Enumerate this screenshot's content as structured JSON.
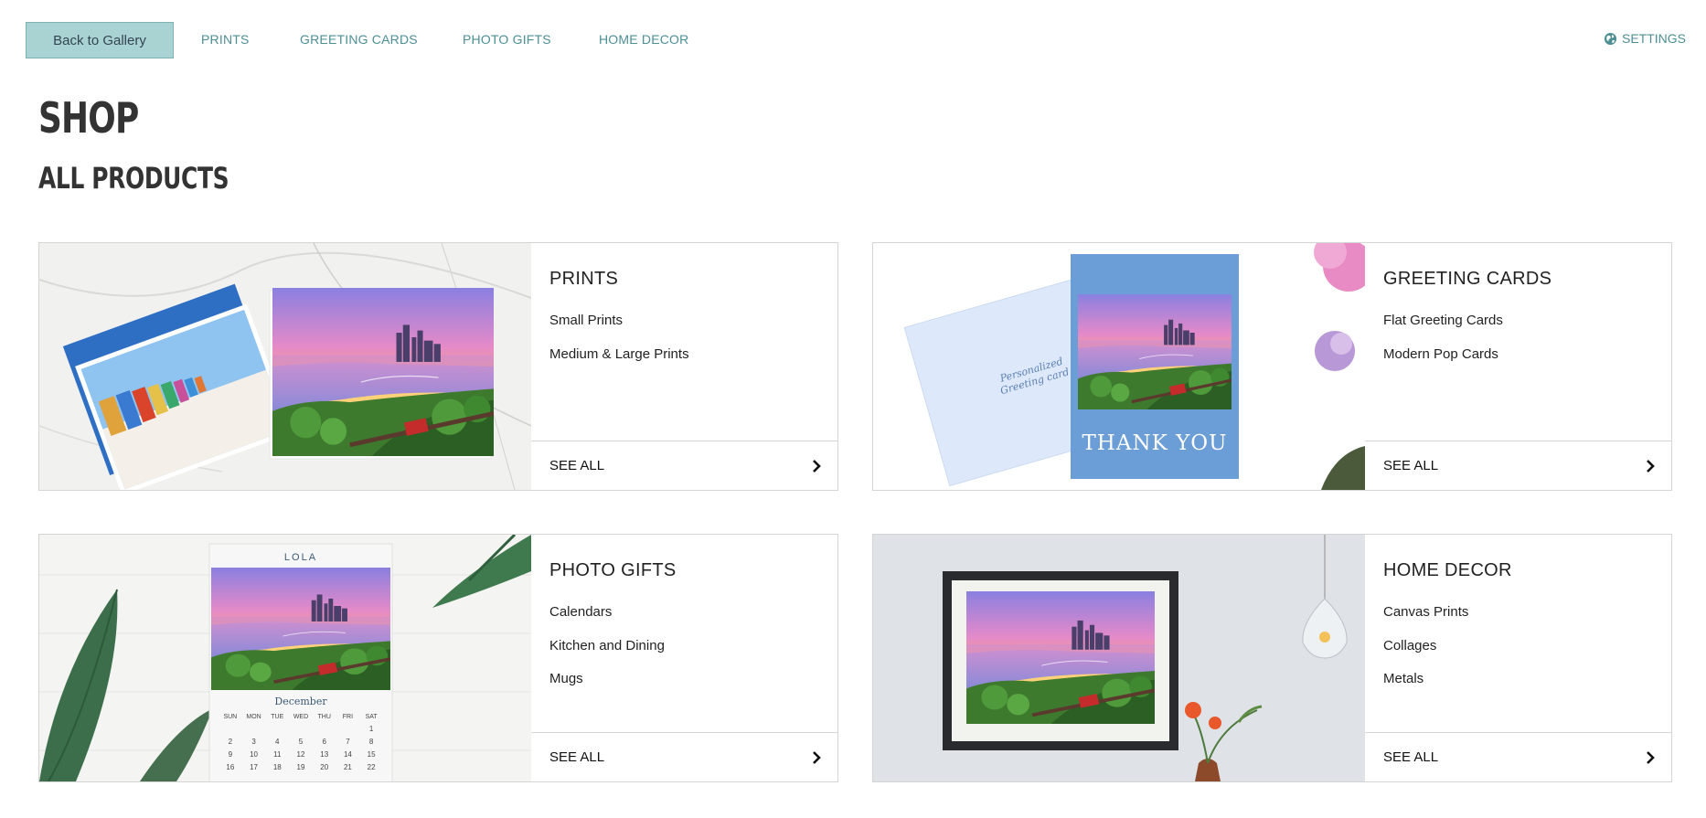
{
  "nav": {
    "back_label": "Back to Gallery",
    "links": [
      "PRINTS",
      "GREETING CARDS",
      "PHOTO GIFTS",
      "HOME DECOR"
    ],
    "settings_label": "SETTINGS",
    "settings_icon": "globe-icon"
  },
  "page": {
    "title": "SHOP",
    "subtitle": "ALL PRODUCTS"
  },
  "cards": [
    {
      "title": "PRINTS",
      "links": [
        "Small Prints",
        "Medium & Large Prints"
      ],
      "see_all": "SEE ALL"
    },
    {
      "title": "GREETING CARDS",
      "links": [
        "Flat Greeting Cards",
        "Modern Pop Cards"
      ],
      "see_all": "SEE ALL",
      "image_text": {
        "envelope": "Personalized Greeting card",
        "card": "THANK YOU"
      }
    },
    {
      "title": "PHOTO GIFTS",
      "links": [
        "Calendars",
        "Kitchen and Dining",
        "Mugs"
      ],
      "see_all": "SEE ALL",
      "image_text": {
        "calendar_name": "LOLA",
        "month": "December",
        "weekdays": [
          "SUN",
          "MON",
          "TUE",
          "WED",
          "THU",
          "FRI",
          "SAT"
        ],
        "days": [
          "1",
          "2",
          "3",
          "4",
          "5",
          "6",
          "7",
          "8",
          "9",
          "10",
          "11",
          "12",
          "13",
          "14",
          "15",
          "16",
          "17",
          "18",
          "19",
          "20",
          "21",
          "22"
        ]
      }
    },
    {
      "title": "HOME DECOR",
      "links": [
        "Canvas Prints",
        "Collages",
        "Metals"
      ],
      "see_all": "SEE ALL"
    }
  ],
  "colors": {
    "accent": "#4d8f93",
    "back_button_bg": "#a9d3d3",
    "card_border": "#d4d4d4",
    "greeting_card_blue": "#6b9dd6"
  }
}
